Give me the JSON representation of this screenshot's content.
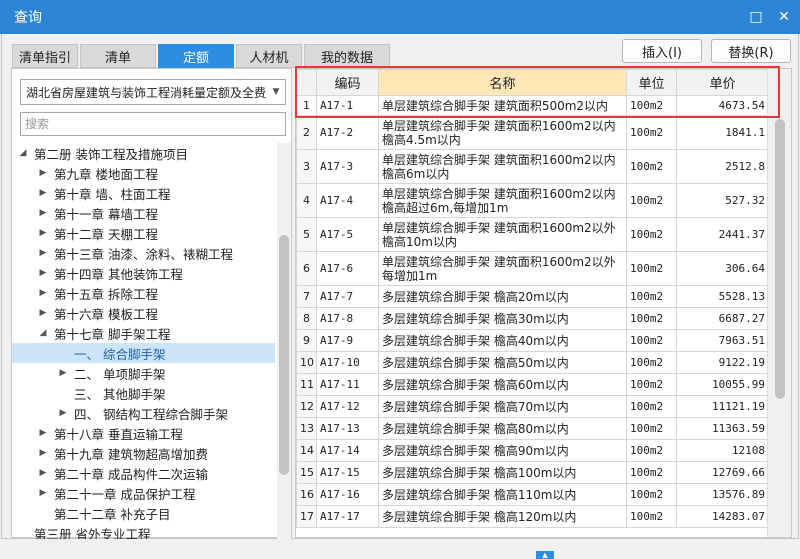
{
  "window": {
    "title": "查询",
    "maximize_glyph": "□",
    "close_glyph": "✕"
  },
  "tabs": [
    {
      "label": "清单指引",
      "active": false
    },
    {
      "label": "清单",
      "active": false
    },
    {
      "label": "定额",
      "active": true
    },
    {
      "label": "人材机",
      "active": false
    },
    {
      "label": "我的数据",
      "active": false
    }
  ],
  "buttons": {
    "insert": "插入(I)",
    "replace": "替换(R)"
  },
  "quota_library": {
    "selected": "湖北省房屋建筑与装饰工程消耗量定额及全费用"
  },
  "search": {
    "placeholder": "搜索",
    "value": ""
  },
  "tree": [
    {
      "label": "第二册 装饰工程及措施项目",
      "level": 0,
      "expanded": true,
      "has_children": true
    },
    {
      "label": "第九章 楼地面工程",
      "level": 1,
      "expanded": false,
      "has_children": true
    },
    {
      "label": "第十章 墙、柱面工程",
      "level": 1,
      "expanded": false,
      "has_children": true
    },
    {
      "label": "第十一章 幕墙工程",
      "level": 1,
      "expanded": false,
      "has_children": true
    },
    {
      "label": "第十二章 天棚工程",
      "level": 1,
      "expanded": false,
      "has_children": true
    },
    {
      "label": "第十三章 油漆、涂料、裱糊工程",
      "level": 1,
      "expanded": false,
      "has_children": true
    },
    {
      "label": "第十四章 其他装饰工程",
      "level": 1,
      "expanded": false,
      "has_children": true
    },
    {
      "label": "第十五章 拆除工程",
      "level": 1,
      "expanded": false,
      "has_children": true
    },
    {
      "label": "第十六章 模板工程",
      "level": 1,
      "expanded": false,
      "has_children": true
    },
    {
      "label": "第十七章 脚手架工程",
      "level": 1,
      "expanded": true,
      "has_children": true
    },
    {
      "label": "一、 综合脚手架",
      "level": 2,
      "expanded": false,
      "has_children": false,
      "selected": true
    },
    {
      "label": "二、 单项脚手架",
      "level": 2,
      "expanded": false,
      "has_children": true
    },
    {
      "label": "三、 其他脚手架",
      "level": 2,
      "expanded": false,
      "has_children": false
    },
    {
      "label": "四、 钢结构工程综合脚手架",
      "level": 2,
      "expanded": false,
      "has_children": true
    },
    {
      "label": "第十八章 垂直运输工程",
      "level": 1,
      "expanded": false,
      "has_children": true
    },
    {
      "label": "第十九章 建筑物超高增加费",
      "level": 1,
      "expanded": false,
      "has_children": true
    },
    {
      "label": "第二十章 成品构件二次运输",
      "level": 1,
      "expanded": false,
      "has_children": true
    },
    {
      "label": "第二十一章 成品保护工程",
      "level": 1,
      "expanded": false,
      "has_children": true
    },
    {
      "label": "第二十二章 补充子目",
      "level": 1,
      "expanded": false,
      "has_children": false
    },
    {
      "label": "第三册 省外专业工程",
      "level": 0,
      "expanded": false,
      "has_children": false
    }
  ],
  "table": {
    "headers": {
      "code": "编码",
      "name": "名称",
      "unit": "单位",
      "price": "单价"
    },
    "rows": [
      {
        "idx": "1",
        "code": "A17-1",
        "name": "单层建筑综合脚手架 建筑面积500m2以内",
        "unit": "100m2",
        "price": "4673.54"
      },
      {
        "idx": "2",
        "code": "A17-2",
        "name": "单层建筑综合脚手架 建筑面积1600m2以内 檐高4.5m以内",
        "unit": "100m2",
        "price": "1841.1"
      },
      {
        "idx": "3",
        "code": "A17-3",
        "name": "单层建筑综合脚手架 建筑面积1600m2以内 檐高6m以内",
        "unit": "100m2",
        "price": "2512.8"
      },
      {
        "idx": "4",
        "code": "A17-4",
        "name": "单层建筑综合脚手架 建筑面积1600m2以内 檐高超过6m,每增加1m",
        "unit": "100m2",
        "price": "527.32"
      },
      {
        "idx": "5",
        "code": "A17-5",
        "name": "单层建筑综合脚手架 建筑面积1600m2以外 檐高10m以内",
        "unit": "100m2",
        "price": "2441.37"
      },
      {
        "idx": "6",
        "code": "A17-6",
        "name": "单层建筑综合脚手架 建筑面积1600m2以外 每增加1m",
        "unit": "100m2",
        "price": "306.64"
      },
      {
        "idx": "7",
        "code": "A17-7",
        "name": "多层建筑综合脚手架 檐高20m以内",
        "unit": "100m2",
        "price": "5528.13"
      },
      {
        "idx": "8",
        "code": "A17-8",
        "name": "多层建筑综合脚手架 檐高30m以内",
        "unit": "100m2",
        "price": "6687.27"
      },
      {
        "idx": "9",
        "code": "A17-9",
        "name": "多层建筑综合脚手架 檐高40m以内",
        "unit": "100m2",
        "price": "7963.51"
      },
      {
        "idx": "10",
        "code": "A17-10",
        "name": "多层建筑综合脚手架 檐高50m以内",
        "unit": "100m2",
        "price": "9122.19"
      },
      {
        "idx": "11",
        "code": "A17-11",
        "name": "多层建筑综合脚手架 檐高60m以内",
        "unit": "100m2",
        "price": "10055.99"
      },
      {
        "idx": "12",
        "code": "A17-12",
        "name": "多层建筑综合脚手架 檐高70m以内",
        "unit": "100m2",
        "price": "11121.19"
      },
      {
        "idx": "13",
        "code": "A17-13",
        "name": "多层建筑综合脚手架 檐高80m以内",
        "unit": "100m2",
        "price": "11363.59"
      },
      {
        "idx": "14",
        "code": "A17-14",
        "name": "多层建筑综合脚手架 檐高90m以内",
        "unit": "100m2",
        "price": "12108"
      },
      {
        "idx": "15",
        "code": "A17-15",
        "name": "多层建筑综合脚手架 檐高100m以内",
        "unit": "100m2",
        "price": "12769.66"
      },
      {
        "idx": "16",
        "code": "A17-16",
        "name": "多层建筑综合脚手架 檐高110m以内",
        "unit": "100m2",
        "price": "13576.89"
      },
      {
        "idx": "17",
        "code": "A17-17",
        "name": "多层建筑综合脚手架 檐高120m以内",
        "unit": "100m2",
        "price": "14283.07"
      }
    ]
  },
  "colors": {
    "title_bar": "#2b84d4",
    "active_tab": "#2b8ee0",
    "name_header": "#ffe7b8",
    "selection_highlight": "#e53935",
    "tree_selected": "#cce4f7"
  }
}
